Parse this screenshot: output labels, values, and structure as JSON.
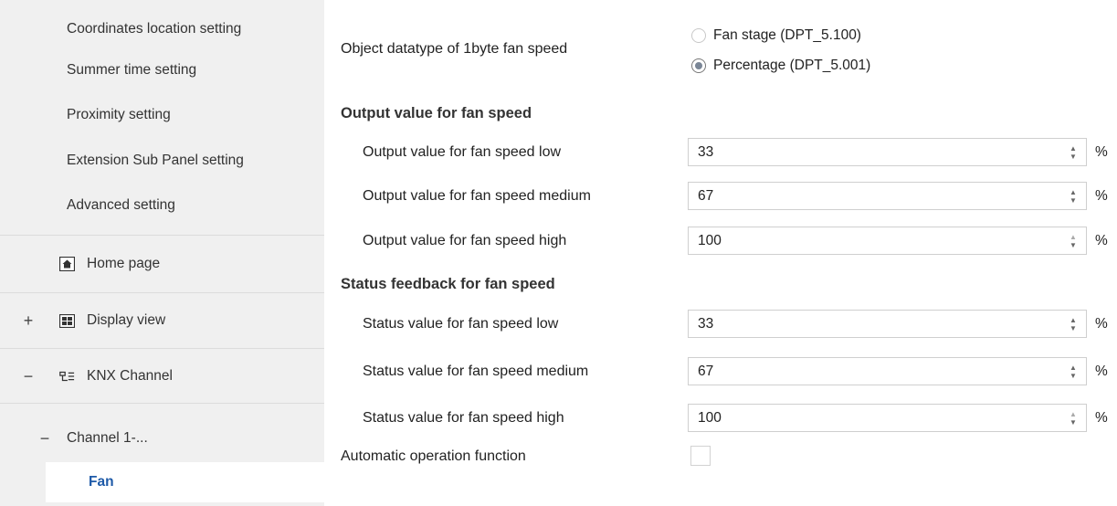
{
  "sidebar": {
    "items": [
      {
        "label": "Coordinates location setting"
      },
      {
        "label": "Summer time setting"
      },
      {
        "label": "Proximity setting"
      },
      {
        "label": "Extension Sub Panel setting"
      },
      {
        "label": "Advanced setting"
      }
    ],
    "home_page": {
      "label": "Home page",
      "icon": "home-icon"
    },
    "display_view": {
      "label": "Display view",
      "expander": "+",
      "icon": "display-grid-icon"
    },
    "knx_channel": {
      "label": "KNX Channel",
      "expander": "−",
      "icon": "knx-channel-icon"
    },
    "channel_1": {
      "label": "Channel 1-...",
      "expander": "−"
    },
    "fan": {
      "label": "Fan"
    }
  },
  "main": {
    "datatype": {
      "label": "Object datatype of 1byte fan speed",
      "options": [
        {
          "label": "Fan stage (DPT_5.100)",
          "checked": false
        },
        {
          "label": "Percentage (DPT_5.001)",
          "checked": true
        }
      ]
    },
    "output_section": {
      "title": "Output value for fan speed",
      "rows": [
        {
          "label": "Output value for fan speed low",
          "value": "33",
          "unit": "%"
        },
        {
          "label": "Output value for fan speed medium",
          "value": "67",
          "unit": "%"
        },
        {
          "label": "Output value for fan speed high",
          "value": "100",
          "unit": "%"
        }
      ]
    },
    "status_section": {
      "title": "Status feedback for fan speed",
      "rows": [
        {
          "label": "Status value for fan speed low",
          "value": "33",
          "unit": "%"
        },
        {
          "label": "Status value for fan speed medium",
          "value": "67",
          "unit": "%"
        },
        {
          "label": "Status value for fan speed high",
          "value": "100",
          "unit": "%"
        }
      ]
    },
    "auto_operation": {
      "label": "Automatic operation function",
      "checked": false
    }
  }
}
